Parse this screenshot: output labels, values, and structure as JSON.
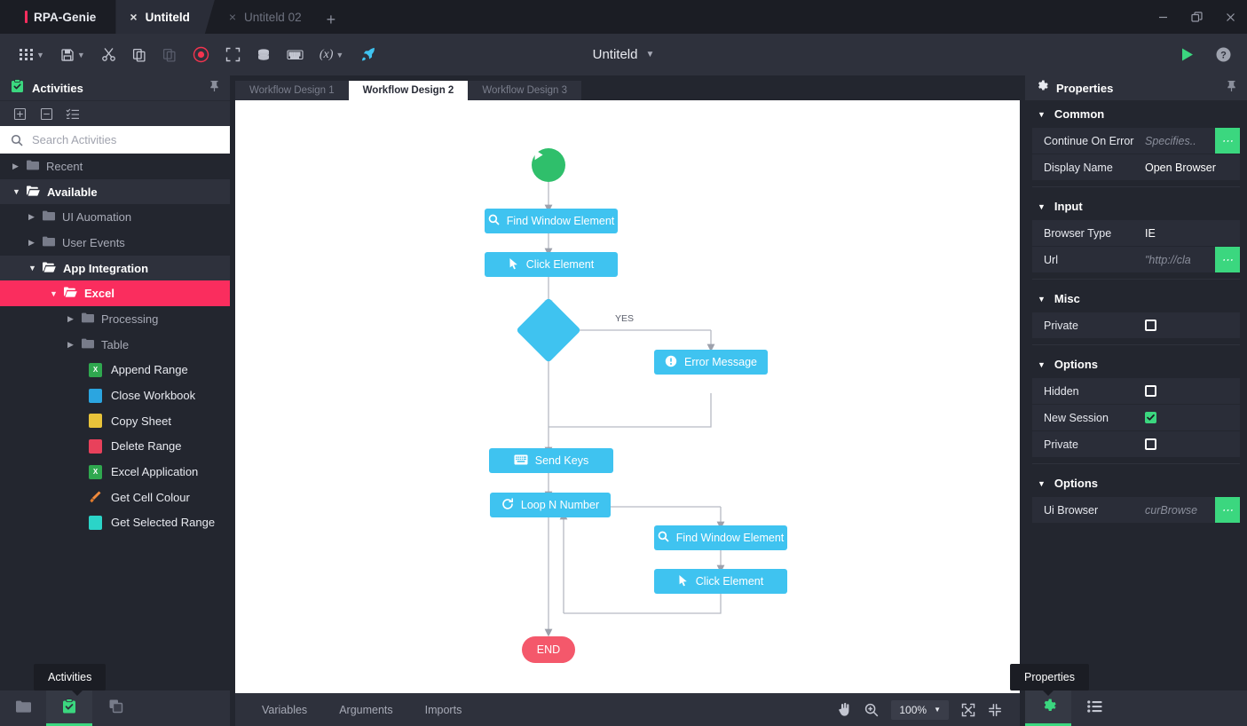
{
  "app": {
    "brand": "RPA-Genie",
    "document_title": "Untiteld"
  },
  "window_tabs": [
    {
      "label": "Untiteld",
      "close": "×",
      "active": true
    },
    {
      "label": "Untiteld 02",
      "close": "×",
      "active": false
    }
  ],
  "window_tab_add": "+",
  "window_controls": {
    "minimize": "minimize-icon",
    "restore": "restore-icon",
    "close": "close-icon"
  },
  "toolbar": {
    "items": [
      {
        "name": "grid-menu-icon",
        "caret": true
      },
      {
        "name": "save-icon",
        "caret": true
      },
      {
        "name": "cut-icon",
        "caret": false
      },
      {
        "name": "copy-icon",
        "caret": false
      },
      {
        "name": "paste-icon",
        "caret": false,
        "disabled": true
      },
      {
        "name": "record-icon",
        "caret": false
      },
      {
        "name": "fullscreen-icon",
        "caret": false
      },
      {
        "name": "database-icon",
        "caret": false
      },
      {
        "name": "keyboard-icon",
        "caret": false
      },
      {
        "name": "variable-icon",
        "caret": true,
        "text": "(x)"
      },
      {
        "name": "publish-rocket-icon",
        "caret": false
      }
    ],
    "run_label": "run-icon",
    "help_label": "help-icon"
  },
  "sidebar": {
    "title": "Activities",
    "pin": "pin-icon",
    "subtools": [
      "expand-all-icon",
      "collapse-all-icon",
      "list-view-icon"
    ],
    "search": {
      "placeholder": "Search Activities",
      "value": ""
    },
    "tree": [
      {
        "label": "Recent",
        "level": 0,
        "state": "collapsed"
      },
      {
        "label": "Available",
        "level": 0,
        "state": "expanded"
      },
      {
        "label": "UI Auomation",
        "level": 1,
        "state": "collapsed"
      },
      {
        "label": "User Events",
        "level": 1,
        "state": "collapsed"
      },
      {
        "label": "App Integration",
        "level": 1,
        "state": "expanded"
      },
      {
        "label": "Excel",
        "level": 2,
        "state": "selected"
      },
      {
        "label": "Processing",
        "level": 3,
        "state": "collapsed"
      },
      {
        "label": "Table",
        "level": 3,
        "state": "collapsed"
      }
    ],
    "activities": [
      {
        "label": "Append Range",
        "icon": "excel-sheet-icon",
        "color": "#2FA84F"
      },
      {
        "label": "Close Workbook",
        "icon": "workbook-icon",
        "color": "#2BA5E0"
      },
      {
        "label": "Copy Sheet",
        "icon": "copy-sheet-icon",
        "color": "#E8C33A"
      },
      {
        "label": "Delete Range",
        "icon": "delete-range-icon",
        "color": "#E8415B"
      },
      {
        "label": "Excel Application",
        "icon": "excel-sheet-icon",
        "color": "#2FA84F"
      },
      {
        "label": "Get Cell Colour",
        "icon": "brush-icon",
        "color": "#F08A3C"
      },
      {
        "label": "Get Selected Range",
        "icon": "selected-range-icon",
        "color": "#2BD4C8"
      }
    ],
    "dock": [
      {
        "name": "dock-files",
        "icon": "folder-icon",
        "active": false
      },
      {
        "name": "dock-activities",
        "icon": "activities-clipboard-icon",
        "active": true
      },
      {
        "name": "dock-snippets",
        "icon": "snippets-icon",
        "active": false
      }
    ],
    "tooltip": "Activities"
  },
  "design": {
    "tabs": [
      {
        "label": "Workflow Design 1",
        "active": false
      },
      {
        "label": "Workflow Design 2",
        "active": true
      },
      {
        "label": "Workflow Design 3",
        "active": false
      }
    ]
  },
  "flow": {
    "start": {
      "label": "",
      "icon": "play-icon"
    },
    "end": {
      "label": "END"
    },
    "edge_labels": [
      {
        "text": "YES"
      }
    ],
    "nodes": [
      {
        "id": "n1",
        "label": "Find Window Element",
        "icon": "search-icon"
      },
      {
        "id": "n2",
        "label": "Click Element",
        "icon": "cursor-icon"
      },
      {
        "id": "n3",
        "label": "",
        "icon": "decision-diamond"
      },
      {
        "id": "n4",
        "label": "Error Message",
        "icon": "alert-icon"
      },
      {
        "id": "n5",
        "label": "Send Keys",
        "icon": "keyboard-icon"
      },
      {
        "id": "n6",
        "label": "Loop N Number",
        "icon": "loop-icon"
      },
      {
        "id": "n7",
        "label": "Find Window Element",
        "icon": "search-icon"
      },
      {
        "id": "n8",
        "label": "Click Element",
        "icon": "cursor-icon"
      }
    ]
  },
  "statusbar": {
    "links": [
      "Variables",
      "Arguments",
      "Imports"
    ],
    "pan": "pan-hand-icon",
    "zoom_tool": "zoom-magnifier-icon",
    "zoom_level": "100%",
    "fit_screen": "fit-screen-icon",
    "collapse_view": "collapse-view-icon"
  },
  "properties": {
    "title": "Properties",
    "pin": "pin-icon",
    "tooltip": "Properties",
    "sections": [
      {
        "name": "Common",
        "rows": [
          {
            "key": "Continue On Error",
            "value": "Specifies..",
            "placeholder": true,
            "dots": true
          },
          {
            "key": "Display Name",
            "value": "Open Browser",
            "placeholder": false,
            "dots": false
          }
        ]
      },
      {
        "name": "Input",
        "rows": [
          {
            "key": "Browser Type",
            "value": "IE",
            "placeholder": false,
            "dots": false
          },
          {
            "key": "Url",
            "value": "\"http://cla",
            "placeholder": true,
            "dots": true
          }
        ]
      },
      {
        "name": "Misc",
        "rows": [
          {
            "key": "Private",
            "checkbox": false
          }
        ]
      },
      {
        "name": "Options",
        "rows": [
          {
            "key": "Hidden",
            "checkbox": false
          },
          {
            "key": "New Session",
            "checkbox": true
          },
          {
            "key": "Private",
            "checkbox": false
          }
        ]
      },
      {
        "name": "Options",
        "rows": [
          {
            "key": "Ui Browser",
            "value": "curBrowse",
            "placeholder": true,
            "dots": true
          }
        ]
      }
    ],
    "dock": [
      {
        "name": "dock-properties",
        "icon": "gear-icon",
        "active": true
      },
      {
        "name": "dock-outline",
        "icon": "list-icon",
        "active": false
      }
    ]
  },
  "colors": {
    "accent_pink": "#FA2D5E",
    "node_blue": "#3FC3F0",
    "start_green": "#2FBF6B",
    "end_red": "#F4586B",
    "action_green": "#3BD77F",
    "panel_bg": "#23262F",
    "chrome_bg": "#2E313C"
  }
}
